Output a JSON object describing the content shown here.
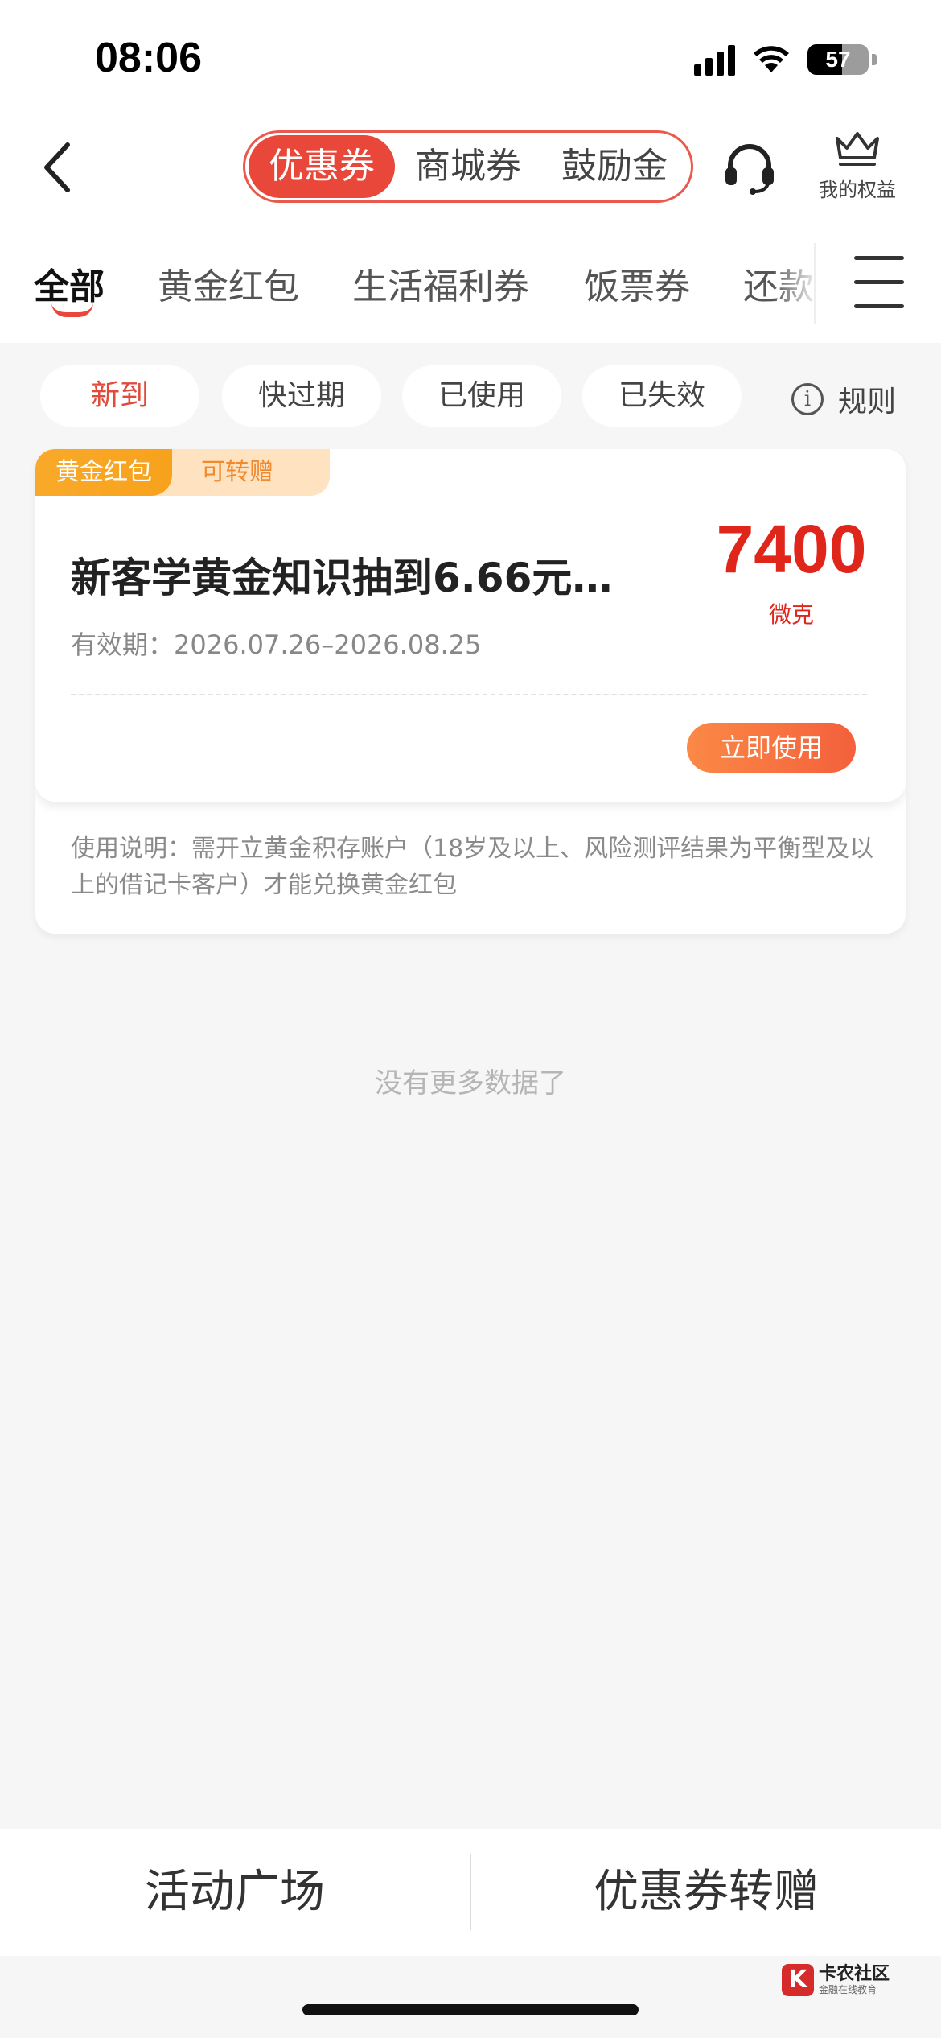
{
  "status_bar": {
    "time": "08:06",
    "battery": "57"
  },
  "top_nav": {
    "segments": [
      "优惠券",
      "商城券",
      "鼓励金"
    ],
    "benefits_label": "我的权益"
  },
  "category_tabs": [
    "全部",
    "黄金红包",
    "生活福利券",
    "饭票券",
    "还款"
  ],
  "filters": [
    "新到",
    "快过期",
    "已使用",
    "已失效"
  ],
  "rules_label": "规则",
  "coupon": {
    "tag": "黄金红包",
    "transfer_tag": "可转赠",
    "title": "新客学黄金知识抽到6.66元…",
    "validity": "有效期：2026.07.26–2026.08.25",
    "amount": "7400",
    "unit": "微克",
    "button": "立即使用",
    "note": "使用说明：需开立黄金积存账户（18岁及以上、风险测评结果为平衡型及以上的借记卡客户）才能兑换黄金红包"
  },
  "no_more": "没有更多数据了",
  "bottom_bar": {
    "left": "活动广场",
    "right": "优惠券转赠"
  },
  "watermark": {
    "title": "卡农社区",
    "subtitle": "金融在线教育"
  },
  "colors": {
    "accent": "#e8473a",
    "amount": "#e0251b",
    "gold": "#f7a21b",
    "button": "#f4603c"
  }
}
